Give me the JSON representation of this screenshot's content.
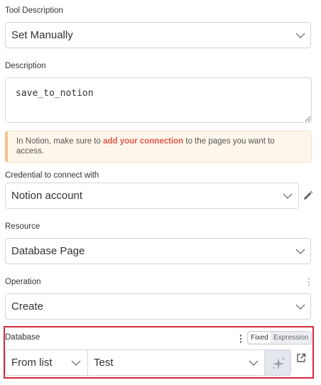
{
  "tool_description": {
    "label": "Tool Description",
    "value": "Set Manually",
    "chevron_icon": "chevron-down-icon"
  },
  "description": {
    "label": "Description",
    "value": "save_to_notion"
  },
  "notice": {
    "text_before": "In Notion, make sure to ",
    "link_text": "add your connection",
    "text_after": " to the pages you want to access.",
    "accent_color": "#f0c58a",
    "link_color": "#e2564a"
  },
  "credential": {
    "label": "Credential to connect with",
    "value": "Notion account",
    "edit_icon": "pencil-icon"
  },
  "resource": {
    "label": "Resource",
    "value": "Database Page"
  },
  "operation": {
    "label": "Operation",
    "value": "Create",
    "options_icon": "kebab-icon"
  },
  "database": {
    "label": "Database",
    "toggle": {
      "fixed": "Fixed",
      "expression": "Expression",
      "active": "Fixed"
    },
    "mode": "From list",
    "value": "Test",
    "ai_icon": "sparkles-icon",
    "open_icon": "external-link-icon",
    "highlight_color": "#d2293a"
  }
}
